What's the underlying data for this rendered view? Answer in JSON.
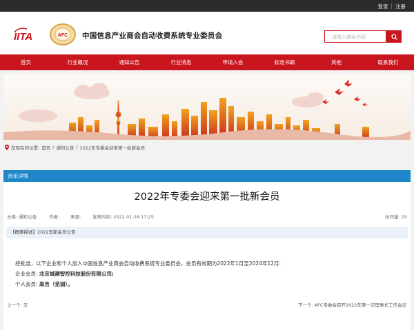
{
  "topbar": {
    "login": "登录",
    "sep": "|",
    "register": "注册"
  },
  "header": {
    "logo_iita": "IITA",
    "logo_afc": "AFC",
    "site_title": "中国信息产业商会自动收费系统专业委员会",
    "search_placeholder": "请输入搜索内容"
  },
  "nav": {
    "items": [
      "首页",
      "行业概况",
      "通知公告",
      "行业消息",
      "申请入会",
      "标准书籍",
      "其他",
      "联系我们"
    ]
  },
  "breadcrumb": {
    "prefix": "您现在的位置:",
    "home": "首页",
    "sep": "/",
    "section": "通知公告",
    "current": "2022年专委会迎来第一批新会员"
  },
  "panel": {
    "header": "资讯详情",
    "title": "2022年专委会迎来第一批新会员",
    "meta": {
      "category": "分类: 通知公告",
      "author": "作者:",
      "source": "来源:",
      "published": "发布时间: 2022-01-28 17:25",
      "views": "访问量: 25"
    },
    "summary": "【概要描述】2022年新会员公告",
    "body": {
      "line1": "经批准，以下企业和个人加入中国信息产业商会自动收费系统专业委员会，会员有效期为2022年1月至2024年12月:",
      "line2_label": "企业会员:",
      "line2_value": "北京城建智控科技股份有限公司;",
      "line3_label": "个人会员:",
      "line3_value": "高吉（芜湖）。"
    },
    "prev": "上一个: 无",
    "next": "下一个: AFC专委会召开2022年第一次理事长工作会议"
  },
  "colors": {
    "brand_red": "#c9151e",
    "panel_blue": "#1e86c9",
    "summary_bg": "#eaf1f8"
  }
}
